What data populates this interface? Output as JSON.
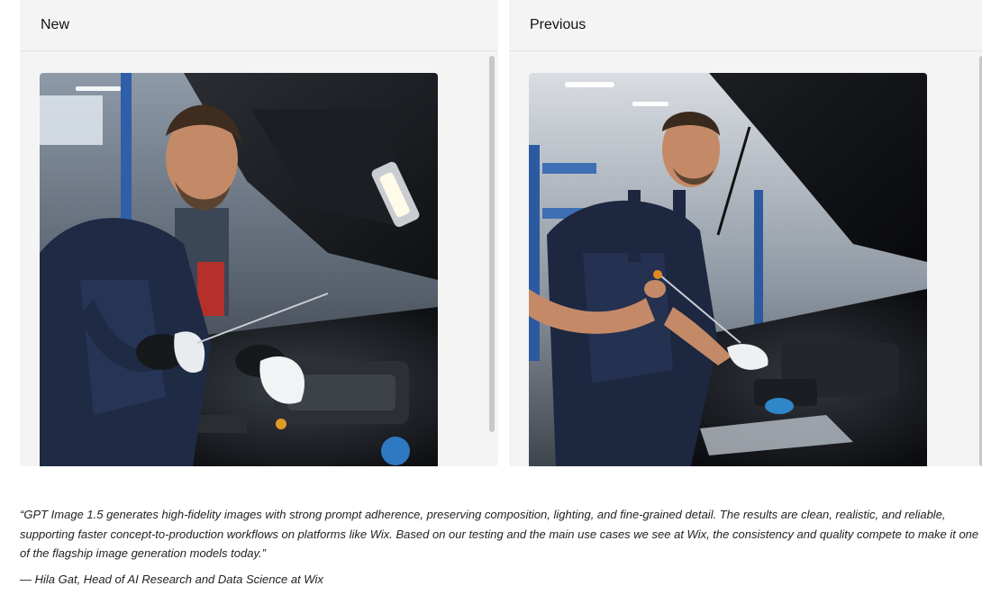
{
  "comparison": {
    "new": {
      "label": "New",
      "image_description": "Mechanic in navy overalls with black gloves checking engine oil dipstick under an open car hood in a workshop"
    },
    "previous": {
      "label": "Previous",
      "image_description": "Mechanic in navy t-shirt and overalls checking engine oil dipstick with a rag under an open car hood in a garage"
    }
  },
  "testimonial": {
    "quote": "“GPT Image 1.5 generates high-fidelity images with strong prompt adherence, preserving composition, lighting, and fine-grained detail. The results are clean, realistic, and reliable, supporting faster concept-to-production workflows on platforms like Wix. Based on our testing and the main use cases we see at Wix, the consistency and quality compete to make it one of the flagship image generation models today.”",
    "attribution": "— Hila Gat, Head of AI Research and Data Science at Wix"
  },
  "colors": {
    "panel_bg": "#f4f4f4",
    "overall_navy": "#1f2b45",
    "engine_black": "#15181d",
    "skin": "#c48a68"
  }
}
